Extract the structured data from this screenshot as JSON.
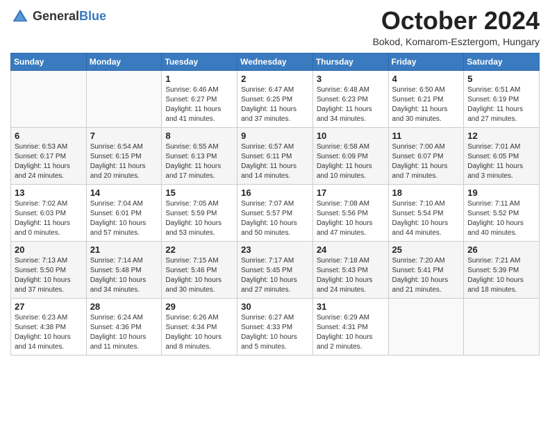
{
  "header": {
    "logo_general": "General",
    "logo_blue": "Blue",
    "month_title": "October 2024",
    "subtitle": "Bokod, Komarom-Esztergom, Hungary"
  },
  "days_of_week": [
    "Sunday",
    "Monday",
    "Tuesday",
    "Wednesday",
    "Thursday",
    "Friday",
    "Saturday"
  ],
  "weeks": [
    [
      {
        "day": "",
        "sunrise": "",
        "sunset": "",
        "daylight": ""
      },
      {
        "day": "",
        "sunrise": "",
        "sunset": "",
        "daylight": ""
      },
      {
        "day": "1",
        "sunrise": "Sunrise: 6:46 AM",
        "sunset": "Sunset: 6:27 PM",
        "daylight": "Daylight: 11 hours and 41 minutes."
      },
      {
        "day": "2",
        "sunrise": "Sunrise: 6:47 AM",
        "sunset": "Sunset: 6:25 PM",
        "daylight": "Daylight: 11 hours and 37 minutes."
      },
      {
        "day": "3",
        "sunrise": "Sunrise: 6:48 AM",
        "sunset": "Sunset: 6:23 PM",
        "daylight": "Daylight: 11 hours and 34 minutes."
      },
      {
        "day": "4",
        "sunrise": "Sunrise: 6:50 AM",
        "sunset": "Sunset: 6:21 PM",
        "daylight": "Daylight: 11 hours and 30 minutes."
      },
      {
        "day": "5",
        "sunrise": "Sunrise: 6:51 AM",
        "sunset": "Sunset: 6:19 PM",
        "daylight": "Daylight: 11 hours and 27 minutes."
      }
    ],
    [
      {
        "day": "6",
        "sunrise": "Sunrise: 6:53 AM",
        "sunset": "Sunset: 6:17 PM",
        "daylight": "Daylight: 11 hours and 24 minutes."
      },
      {
        "day": "7",
        "sunrise": "Sunrise: 6:54 AM",
        "sunset": "Sunset: 6:15 PM",
        "daylight": "Daylight: 11 hours and 20 minutes."
      },
      {
        "day": "8",
        "sunrise": "Sunrise: 6:55 AM",
        "sunset": "Sunset: 6:13 PM",
        "daylight": "Daylight: 11 hours and 17 minutes."
      },
      {
        "day": "9",
        "sunrise": "Sunrise: 6:57 AM",
        "sunset": "Sunset: 6:11 PM",
        "daylight": "Daylight: 11 hours and 14 minutes."
      },
      {
        "day": "10",
        "sunrise": "Sunrise: 6:58 AM",
        "sunset": "Sunset: 6:09 PM",
        "daylight": "Daylight: 11 hours and 10 minutes."
      },
      {
        "day": "11",
        "sunrise": "Sunrise: 7:00 AM",
        "sunset": "Sunset: 6:07 PM",
        "daylight": "Daylight: 11 hours and 7 minutes."
      },
      {
        "day": "12",
        "sunrise": "Sunrise: 7:01 AM",
        "sunset": "Sunset: 6:05 PM",
        "daylight": "Daylight: 11 hours and 3 minutes."
      }
    ],
    [
      {
        "day": "13",
        "sunrise": "Sunrise: 7:02 AM",
        "sunset": "Sunset: 6:03 PM",
        "daylight": "Daylight: 11 hours and 0 minutes."
      },
      {
        "day": "14",
        "sunrise": "Sunrise: 7:04 AM",
        "sunset": "Sunset: 6:01 PM",
        "daylight": "Daylight: 10 hours and 57 minutes."
      },
      {
        "day": "15",
        "sunrise": "Sunrise: 7:05 AM",
        "sunset": "Sunset: 5:59 PM",
        "daylight": "Daylight: 10 hours and 53 minutes."
      },
      {
        "day": "16",
        "sunrise": "Sunrise: 7:07 AM",
        "sunset": "Sunset: 5:57 PM",
        "daylight": "Daylight: 10 hours and 50 minutes."
      },
      {
        "day": "17",
        "sunrise": "Sunrise: 7:08 AM",
        "sunset": "Sunset: 5:56 PM",
        "daylight": "Daylight: 10 hours and 47 minutes."
      },
      {
        "day": "18",
        "sunrise": "Sunrise: 7:10 AM",
        "sunset": "Sunset: 5:54 PM",
        "daylight": "Daylight: 10 hours and 44 minutes."
      },
      {
        "day": "19",
        "sunrise": "Sunrise: 7:11 AM",
        "sunset": "Sunset: 5:52 PM",
        "daylight": "Daylight: 10 hours and 40 minutes."
      }
    ],
    [
      {
        "day": "20",
        "sunrise": "Sunrise: 7:13 AM",
        "sunset": "Sunset: 5:50 PM",
        "daylight": "Daylight: 10 hours and 37 minutes."
      },
      {
        "day": "21",
        "sunrise": "Sunrise: 7:14 AM",
        "sunset": "Sunset: 5:48 PM",
        "daylight": "Daylight: 10 hours and 34 minutes."
      },
      {
        "day": "22",
        "sunrise": "Sunrise: 7:15 AM",
        "sunset": "Sunset: 5:46 PM",
        "daylight": "Daylight: 10 hours and 30 minutes."
      },
      {
        "day": "23",
        "sunrise": "Sunrise: 7:17 AM",
        "sunset": "Sunset: 5:45 PM",
        "daylight": "Daylight: 10 hours and 27 minutes."
      },
      {
        "day": "24",
        "sunrise": "Sunrise: 7:18 AM",
        "sunset": "Sunset: 5:43 PM",
        "daylight": "Daylight: 10 hours and 24 minutes."
      },
      {
        "day": "25",
        "sunrise": "Sunrise: 7:20 AM",
        "sunset": "Sunset: 5:41 PM",
        "daylight": "Daylight: 10 hours and 21 minutes."
      },
      {
        "day": "26",
        "sunrise": "Sunrise: 7:21 AM",
        "sunset": "Sunset: 5:39 PM",
        "daylight": "Daylight: 10 hours and 18 minutes."
      }
    ],
    [
      {
        "day": "27",
        "sunrise": "Sunrise: 6:23 AM",
        "sunset": "Sunset: 4:38 PM",
        "daylight": "Daylight: 10 hours and 14 minutes."
      },
      {
        "day": "28",
        "sunrise": "Sunrise: 6:24 AM",
        "sunset": "Sunset: 4:36 PM",
        "daylight": "Daylight: 10 hours and 11 minutes."
      },
      {
        "day": "29",
        "sunrise": "Sunrise: 6:26 AM",
        "sunset": "Sunset: 4:34 PM",
        "daylight": "Daylight: 10 hours and 8 minutes."
      },
      {
        "day": "30",
        "sunrise": "Sunrise: 6:27 AM",
        "sunset": "Sunset: 4:33 PM",
        "daylight": "Daylight: 10 hours and 5 minutes."
      },
      {
        "day": "31",
        "sunrise": "Sunrise: 6:29 AM",
        "sunset": "Sunset: 4:31 PM",
        "daylight": "Daylight: 10 hours and 2 minutes."
      },
      {
        "day": "",
        "sunrise": "",
        "sunset": "",
        "daylight": ""
      },
      {
        "day": "",
        "sunrise": "",
        "sunset": "",
        "daylight": ""
      }
    ]
  ]
}
